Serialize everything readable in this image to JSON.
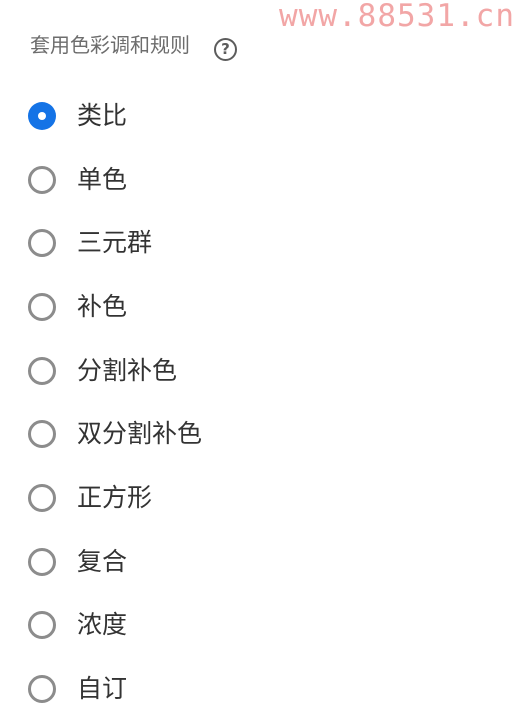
{
  "watermark": "www.88531.cn",
  "panel": {
    "title": "套用色彩调和规则",
    "help_icon": "question-mark-icon",
    "help_glyph": "?",
    "accent_color": "#1473e6",
    "selected_index": 0,
    "options": [
      {
        "label": "类比",
        "checked": true
      },
      {
        "label": "单色",
        "checked": false
      },
      {
        "label": "三元群",
        "checked": false
      },
      {
        "label": "补色",
        "checked": false
      },
      {
        "label": "分割补色",
        "checked": false
      },
      {
        "label": "双分割补色",
        "checked": false
      },
      {
        "label": "正方形",
        "checked": false
      },
      {
        "label": "复合",
        "checked": false
      },
      {
        "label": "浓度",
        "checked": false
      },
      {
        "label": "自订",
        "checked": false
      }
    ]
  }
}
